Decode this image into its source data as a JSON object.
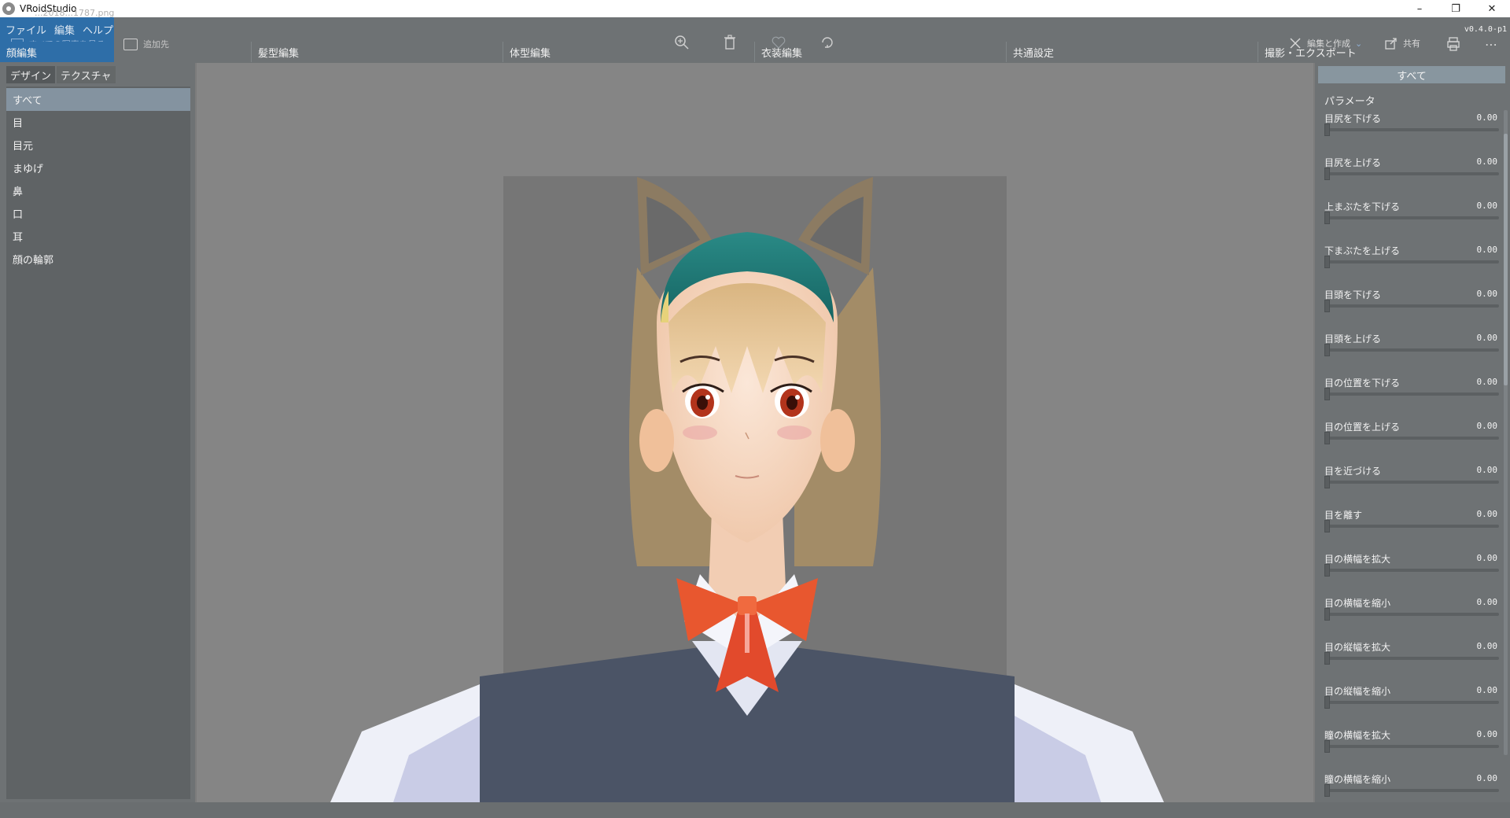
{
  "window": {
    "title": "VRoidStudio",
    "ghost_filename": "...2018...1787.png",
    "controls": {
      "minimize": "–",
      "restore": "❐",
      "close": "✕"
    }
  },
  "menu": {
    "items": [
      "ファイル",
      "編集",
      "ヘルプ"
    ]
  },
  "overlay": {
    "see_all_photos": "すべての写真を見る",
    "add_to": "追加先",
    "edit_create": "編集と作成",
    "share": "共有"
  },
  "tabs": [
    {
      "label": "顔編集",
      "active": true
    },
    {
      "label": "髪型編集",
      "active": false
    },
    {
      "label": "体型編集",
      "active": false
    },
    {
      "label": "衣装編集",
      "active": false
    },
    {
      "label": "共通設定",
      "active": false
    },
    {
      "label": "撮影・エクスポート",
      "active": false
    }
  ],
  "version": "v0.4.0-p1",
  "left_panel": {
    "tabs": [
      "デザイン",
      "テクスチャ"
    ],
    "categories": [
      "すべて",
      "目",
      "目元",
      "まゆげ",
      "鼻",
      "口",
      "耳",
      "顔の輪郭"
    ],
    "selected_category": "すべて"
  },
  "right_panel": {
    "header": "すべて",
    "section_title": "パラメータ",
    "params": [
      {
        "label": "目尻を下げる",
        "value": "0.00"
      },
      {
        "label": "目尻を上げる",
        "value": "0.00"
      },
      {
        "label": "上まぶたを下げる",
        "value": "0.00"
      },
      {
        "label": "下まぶたを上げる",
        "value": "0.00"
      },
      {
        "label": "目頭を下げる",
        "value": "0.00"
      },
      {
        "label": "目頭を上げる",
        "value": "0.00"
      },
      {
        "label": "目の位置を下げる",
        "value": "0.00"
      },
      {
        "label": "目の位置を上げる",
        "value": "0.00"
      },
      {
        "label": "目を近づける",
        "value": "0.00"
      },
      {
        "label": "目を離す",
        "value": "0.00"
      },
      {
        "label": "目の横幅を拡大",
        "value": "0.00"
      },
      {
        "label": "目の横幅を縮小",
        "value": "0.00"
      },
      {
        "label": "目の縦幅を拡大",
        "value": "0.00"
      },
      {
        "label": "目の縦幅を縮小",
        "value": "0.00"
      },
      {
        "label": "瞳の横幅を拡大",
        "value": "0.00"
      },
      {
        "label": "瞳の横幅を縮小",
        "value": "0.00"
      }
    ]
  },
  "colors": {
    "accent": "#2e6ea8",
    "panel": "#6e7274",
    "viewport": "#858585",
    "hair": "#1f7f7c",
    "hair_tan": "#c7a872",
    "bow": "#e8572f",
    "vest": "#4b5466"
  },
  "icons": {
    "zoom": "zoom-in-icon",
    "trash": "trash-icon",
    "heart": "heart-icon",
    "rotate": "rotate-icon",
    "share": "share-icon",
    "print": "print-icon",
    "more": "more-icon"
  }
}
